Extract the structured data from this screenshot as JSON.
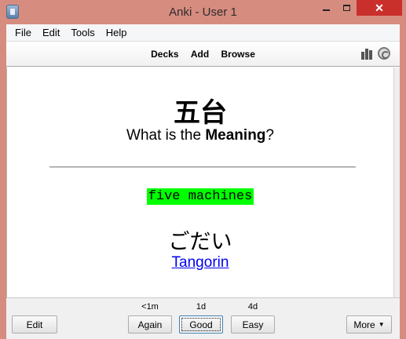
{
  "window": {
    "title": "Anki - User 1"
  },
  "menu": {
    "items": [
      "File",
      "Edit",
      "Tools",
      "Help"
    ]
  },
  "toolbar": {
    "links": [
      "Decks",
      "Add",
      "Browse"
    ],
    "icons": [
      "stats-icon",
      "sync-icon"
    ]
  },
  "card": {
    "kanji": "五台",
    "question_prefix": "What is the ",
    "question_bold": "Meaning",
    "question_suffix": "?",
    "answer": "five machines",
    "answer_highlight_color": "#00ff00",
    "reading": "ごだい",
    "link": "Tangorin"
  },
  "answer_buttons": {
    "edit": "Edit",
    "more": "More",
    "buttons": [
      {
        "label": "Again",
        "due": "<1m"
      },
      {
        "label": "Good",
        "due": "1d"
      },
      {
        "label": "Easy",
        "due": "4d"
      }
    ]
  },
  "colors": {
    "frame": "#d78c80",
    "close": "#c9302c",
    "link": "#0000ee"
  }
}
